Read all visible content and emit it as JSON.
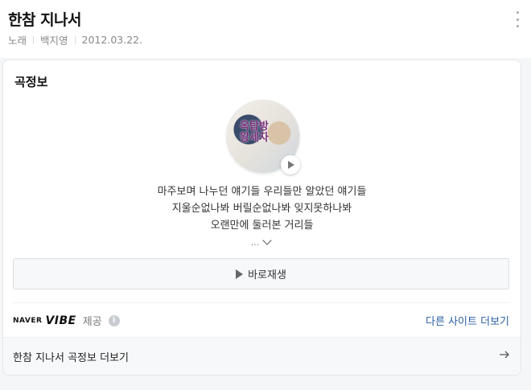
{
  "header": {
    "title": "한참 지나서",
    "category": "노래",
    "artist": "백지영",
    "date": "2012.03.22."
  },
  "card": {
    "title": "곡정보",
    "album_art_text_top": "옥탑방",
    "album_art_text_bottom": "왕세자",
    "lyrics": [
      "마주보며 나누던 얘기들 우리들만 알았던 얘기들",
      "지울순없나봐 버릴순없나봐 잊지못하나봐",
      "오랜만에 둘러본 거리들"
    ],
    "more_label": "...",
    "play_label": "바로재생",
    "provider_brand": "NAVER",
    "provider_name": "VIBE",
    "provider_suffix": "제공",
    "info_icon": "i",
    "other_sites_label": "다른 사이트 더보기",
    "footer_label": "한참 지나서 곡정보 더보기"
  },
  "colors": {
    "link": "#2a5fa6",
    "background": "#f5f6f8"
  }
}
